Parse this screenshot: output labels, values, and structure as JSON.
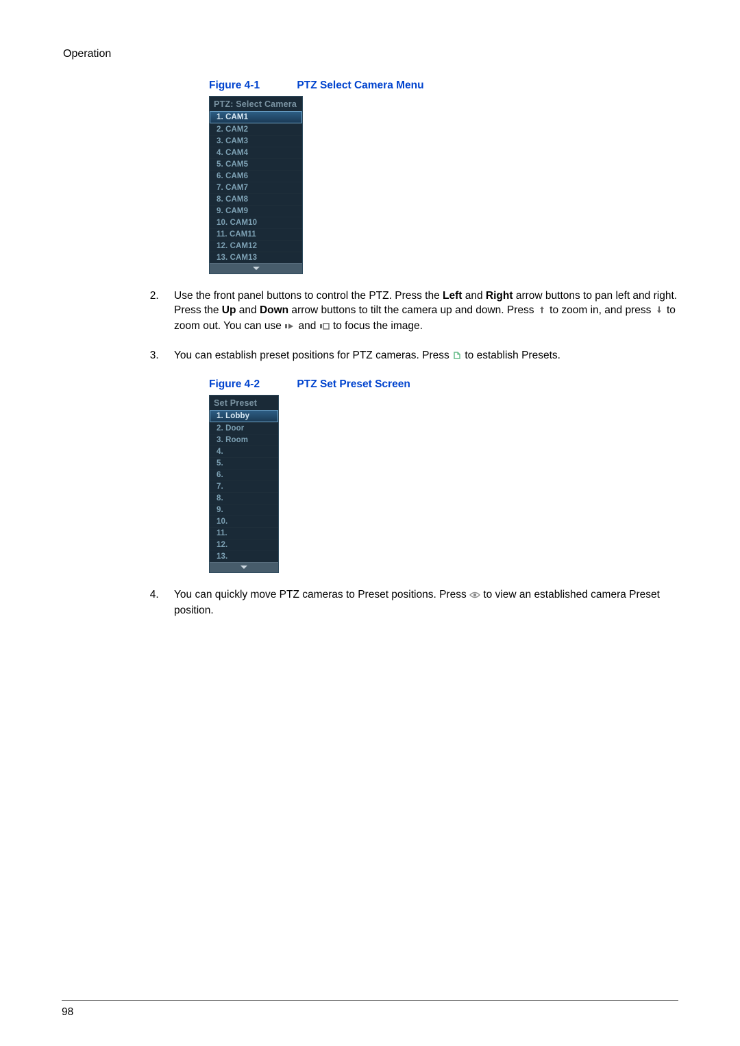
{
  "header": {
    "section_title": "Operation"
  },
  "figure1": {
    "label": "Figure 4-1",
    "caption": "PTZ Select Camera Menu",
    "menu_title": "PTZ: Select Camera",
    "items": [
      {
        "num": "1.",
        "name": "CAM1",
        "selected": true
      },
      {
        "num": "2.",
        "name": "CAM2"
      },
      {
        "num": "3.",
        "name": "CAM3"
      },
      {
        "num": "4.",
        "name": "CAM4"
      },
      {
        "num": "5.",
        "name": "CAM5"
      },
      {
        "num": "6.",
        "name": "CAM6"
      },
      {
        "num": "7.",
        "name": "CAM7"
      },
      {
        "num": "8.",
        "name": "CAM8"
      },
      {
        "num": "9.",
        "name": "CAM9"
      },
      {
        "num": "10.",
        "name": "CAM10"
      },
      {
        "num": "11.",
        "name": "CAM11"
      },
      {
        "num": "12.",
        "name": "CAM12"
      },
      {
        "num": "13.",
        "name": "CAM13"
      }
    ]
  },
  "figure2": {
    "label": "Figure 4-2",
    "caption": "PTZ Set Preset Screen",
    "menu_title": "Set Preset",
    "items": [
      {
        "num": "1.",
        "name": "Lobby",
        "selected": true
      },
      {
        "num": "2.",
        "name": "Door"
      },
      {
        "num": "3.",
        "name": "Room"
      },
      {
        "num": "4.",
        "name": ""
      },
      {
        "num": "5.",
        "name": ""
      },
      {
        "num": "6.",
        "name": ""
      },
      {
        "num": "7.",
        "name": ""
      },
      {
        "num": "8.",
        "name": ""
      },
      {
        "num": "9.",
        "name": ""
      },
      {
        "num": "10.",
        "name": ""
      },
      {
        "num": "11.",
        "name": ""
      },
      {
        "num": "12.",
        "name": ""
      },
      {
        "num": "13.",
        "name": ""
      }
    ]
  },
  "step2": {
    "t1": "Use the front panel buttons to control the PTZ. Press the ",
    "b1": "Left",
    "t2": " and ",
    "b2": "Right",
    "t3": " arrow buttons to pan left and right. Press the ",
    "b3": "Up",
    "t4": " and ",
    "b4": "Down",
    "t5": " arrow buttons to tilt the camera up and down. Press ",
    "t6": " to zoom in, and press ",
    "t7": " to zoom out. You can use ",
    "t8": " and ",
    "t9": " to focus the image."
  },
  "step3": {
    "t1": "You can establish preset positions for PTZ cameras. Press ",
    "t2": " to establish Presets."
  },
  "step4": {
    "t1": "You can quickly move PTZ cameras to Preset positions. Press ",
    "t2": " to view an established camera Preset position."
  },
  "page_number": "98"
}
